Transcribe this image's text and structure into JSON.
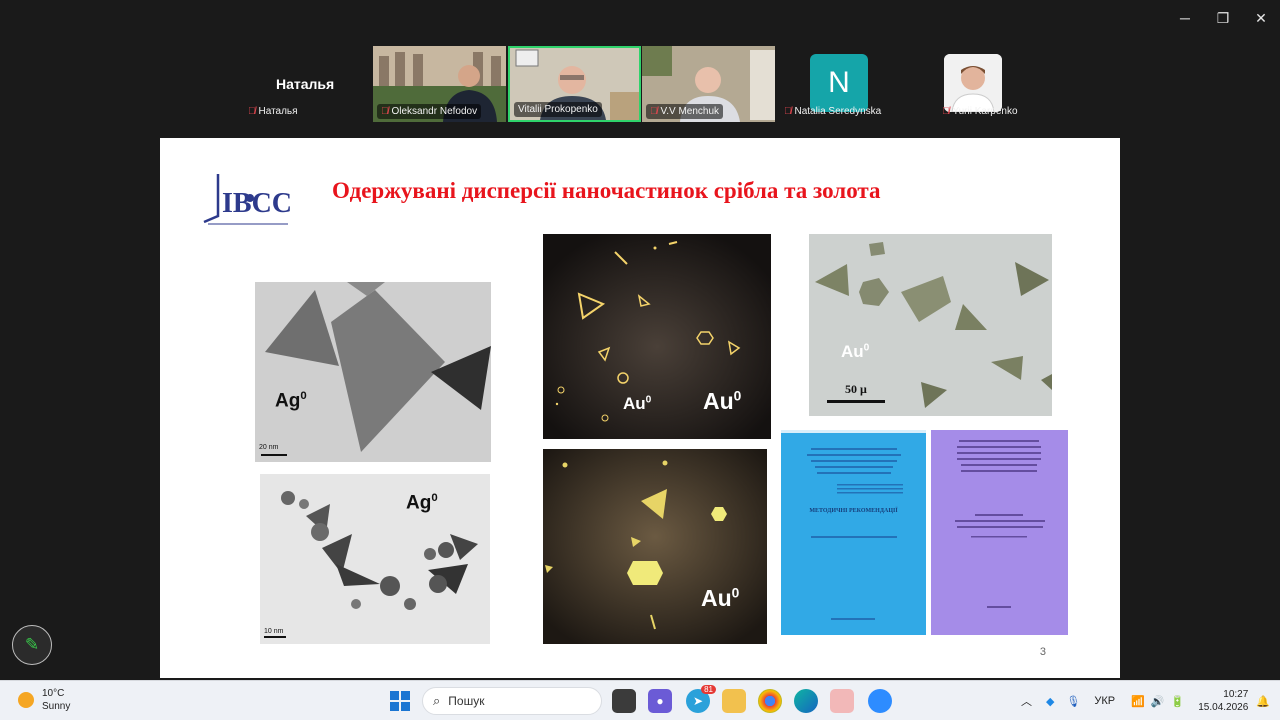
{
  "window": {
    "minimize": "─",
    "restore": "❐",
    "close": "✕"
  },
  "participants": {
    "active_speaker": "Наталья",
    "tiles": [
      {
        "name": "Наталья",
        "muted": true
      },
      {
        "name": "Oleksandr Nefodov",
        "muted": true
      },
      {
        "name": "Vitalii Prokopenko",
        "muted": false
      },
      {
        "name": "V.V Menchuk",
        "muted": true
      },
      {
        "name": "Natalia Seredynska",
        "muted": true,
        "avatar_letter": "N"
      },
      {
        "name": "Yurii Karpenko",
        "muted": true
      }
    ]
  },
  "slide": {
    "title": "Одержувані дисперсії наночастинок срібла та золота",
    "logo_text": "IBCC",
    "page_number": "3",
    "labels": {
      "ag": "Ag",
      "au": "Au",
      "superscript": "0",
      "scale_50": "50 μ",
      "scale_20nm": "20 nm",
      "scale_10nm": "10 nm"
    },
    "doc_blue": {
      "heading": "МЕТОДИЧНІ РЕКОМЕНДАЦІЇ"
    }
  },
  "taskbar": {
    "weather": {
      "temp": "10°C",
      "condition": "Sunny"
    },
    "search_placeholder": "Пошук",
    "telegram_badge": "81",
    "language": "УКР",
    "time": "10:27",
    "date": "15.04.2026"
  },
  "colors": {
    "title_red": "#e8141c",
    "zoom_green": "#2fd36b",
    "doc_blue": "#2aa4e4",
    "doc_violet": "#a088e8"
  }
}
